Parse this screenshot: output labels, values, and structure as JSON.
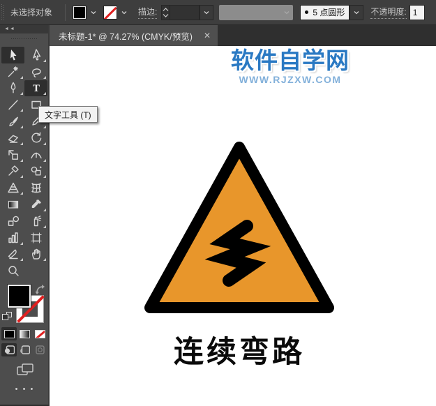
{
  "options_bar": {
    "selection_status": "未选择对象",
    "fill_swatch": "black",
    "stroke_swatch": "none",
    "stroke_label": "描边:",
    "stroke_value": "",
    "profile_dropdown_value": "",
    "brush_preset": {
      "bullet": "",
      "label": "5 点圆形"
    },
    "opacity_label": "不透明度:",
    "opacity_value_visible": "1"
  },
  "tab_bar": {
    "active_tab": {
      "title": "未标题-1* @ 74.27% (CMYK/预览)",
      "close_glyph": "✕"
    }
  },
  "toolbar": {
    "collapse_glyph": "◄◄",
    "more_glyph": "• • •",
    "tools": [
      {
        "id": "selection",
        "active": true,
        "flyout": false
      },
      {
        "id": "direct-selection",
        "active": false,
        "flyout": true
      },
      {
        "id": "magic-wand",
        "active": false,
        "flyout": true
      },
      {
        "id": "lasso",
        "active": false,
        "flyout": true
      },
      {
        "id": "pen",
        "active": false,
        "flyout": true
      },
      {
        "id": "type",
        "active": true,
        "flyout": true
      },
      {
        "id": "line-segment",
        "active": false,
        "flyout": true
      },
      {
        "id": "rectangle",
        "active": false,
        "flyout": true
      },
      {
        "id": "paintbrush",
        "active": false,
        "flyout": true
      },
      {
        "id": "pencil",
        "active": false,
        "flyout": true
      },
      {
        "id": "eraser",
        "active": false,
        "flyout": true
      },
      {
        "id": "rotate",
        "active": false,
        "flyout": true
      },
      {
        "id": "scale",
        "active": false,
        "flyout": true
      },
      {
        "id": "width",
        "active": false,
        "flyout": true
      },
      {
        "id": "free-transform",
        "active": false,
        "flyout": true
      },
      {
        "id": "shape-builder",
        "active": false,
        "flyout": true
      },
      {
        "id": "perspective-grid",
        "active": false,
        "flyout": true
      },
      {
        "id": "mesh",
        "active": false,
        "flyout": false
      },
      {
        "id": "gradient",
        "active": false,
        "flyout": false
      },
      {
        "id": "eyedropper",
        "active": false,
        "flyout": true
      },
      {
        "id": "blend",
        "active": false,
        "flyout": false
      },
      {
        "id": "symbol-sprayer",
        "active": false,
        "flyout": true
      },
      {
        "id": "column-graph",
        "active": false,
        "flyout": true
      },
      {
        "id": "artboard",
        "active": false,
        "flyout": false
      },
      {
        "id": "slice",
        "active": false,
        "flyout": true
      },
      {
        "id": "hand",
        "active": false,
        "flyout": true
      },
      {
        "id": "zoom",
        "active": false,
        "flyout": false
      }
    ]
  },
  "tooltip": {
    "text": "文字工具 (T)"
  },
  "canvas": {
    "watermark": {
      "title": "软件自学网",
      "subtitle": "WWW.RJZXW.COM",
      "title_color": "#2a79c3",
      "subtitle_color": "#82b0da"
    },
    "sign": {
      "label": "连续弯路",
      "triangle_fill": "#e8962b",
      "outline_color": "#000000"
    }
  }
}
